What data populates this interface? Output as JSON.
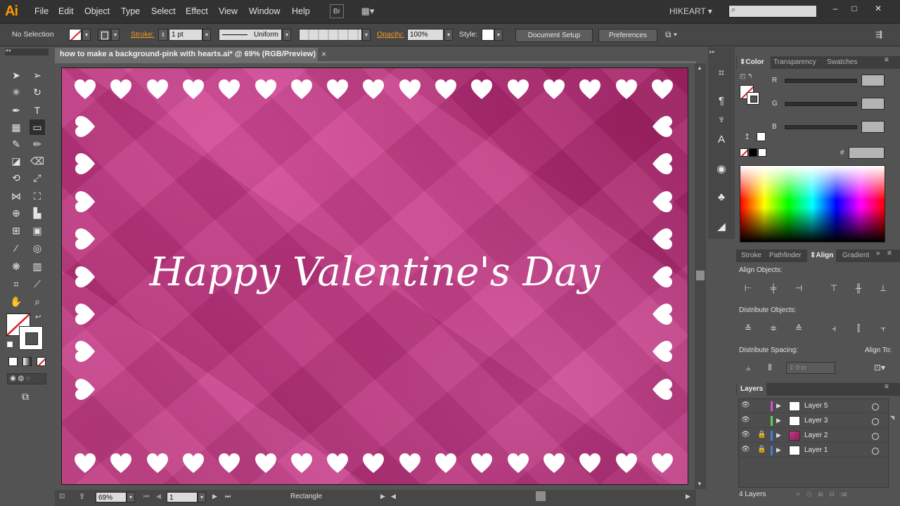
{
  "app": {
    "logo": "Ai",
    "user": "HIKEART"
  },
  "menu": [
    "File",
    "Edit",
    "Object",
    "Type",
    "Select",
    "Effect",
    "View",
    "Window",
    "Help"
  ],
  "menubar_buttons": {
    "bridge": "Br"
  },
  "control": {
    "selection": "No Selection",
    "stroke_label": "Stroke:",
    "stroke_value": "1 pt",
    "profile": "Uniform",
    "opacity_label": "Opacity:",
    "opacity_value": "100%",
    "style_label": "Style:",
    "document_setup": "Document Setup",
    "preferences": "Preferences"
  },
  "document": {
    "tab_title": "how to make a background-pink with hearts.ai* @ 69% (RGB/Preview)",
    "tab_close": "×",
    "headline": "Happy Valentine's Day",
    "colors": {
      "bg": "#b0286f",
      "heart": "#ffffff"
    }
  },
  "status": {
    "zoom": "69%",
    "page": "1",
    "tool": "Rectangle"
  },
  "color_panel": {
    "tabs": [
      "Color",
      "Transparency",
      "Swatches"
    ],
    "r_label": "R",
    "g_label": "G",
    "b_label": "B",
    "hex_label": "#"
  },
  "align_panel": {
    "tabs": [
      "Stroke",
      "Pathfinder",
      "Align",
      "Gradient"
    ],
    "align_objects": "Align Objects:",
    "distribute_objects": "Distribute Objects:",
    "distribute_spacing": "Distribute Spacing:",
    "align_to": "Align To:",
    "spacing_value": "0 in"
  },
  "layers_panel": {
    "title": "Layers",
    "layers": [
      {
        "name": "Layer 5",
        "color": "#d84fd0"
      },
      {
        "name": "Layer 3",
        "color": "#5ad35a"
      },
      {
        "name": "Layer 2",
        "color": "#3f7ddc"
      },
      {
        "name": "Layer 1",
        "color": "#3f7ddc"
      }
    ],
    "count": "4 Layers"
  }
}
